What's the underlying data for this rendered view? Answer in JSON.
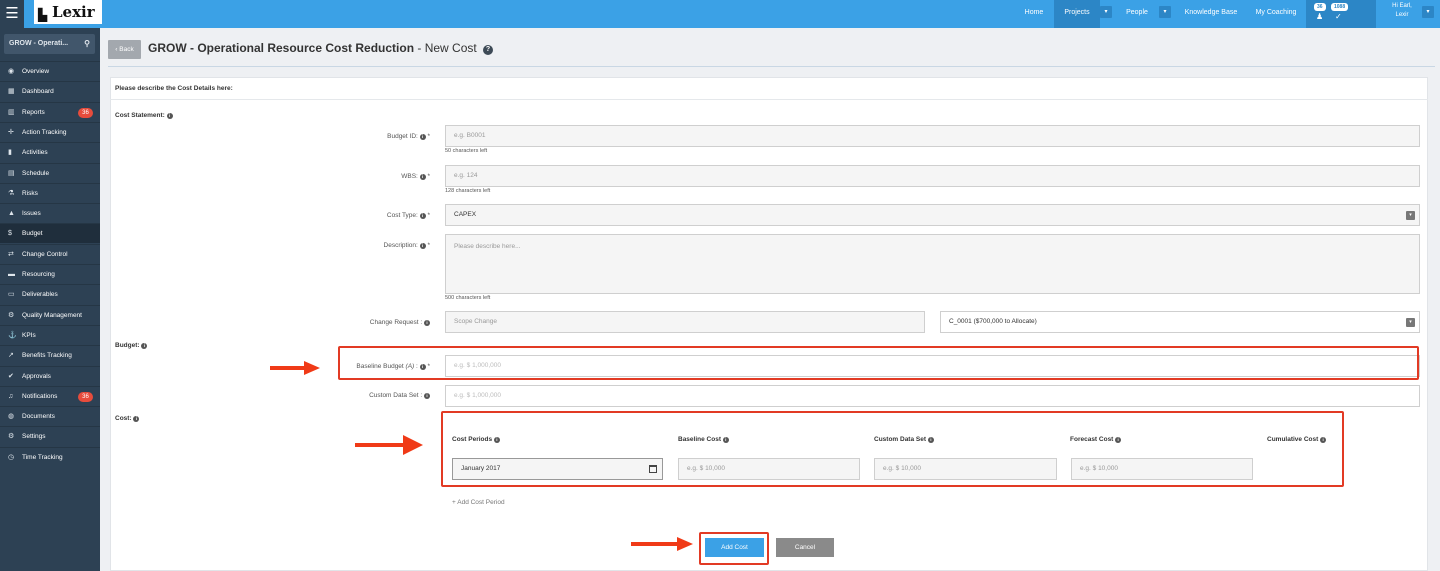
{
  "app": {
    "brand": "Lexir",
    "menu_icon": "hamburger-icon"
  },
  "topnav": {
    "items": [
      "Home",
      "Projects",
      "People",
      "Knowledge Base",
      "My Coaching"
    ],
    "notifications_count": "36",
    "messages_count": "1088",
    "user_greeting": "Hi Earl,",
    "user_name": "Lexir",
    "accent_color": "#3ba1e6"
  },
  "sidebar": {
    "search_text": "GROW - Operati...",
    "items": [
      {
        "label": "Overview",
        "icon": "eye-icon"
      },
      {
        "label": "Dashboard",
        "icon": "dashboard-icon"
      },
      {
        "label": "Reports",
        "icon": "chart-icon",
        "badge": "36"
      },
      {
        "label": "Action Tracking",
        "icon": "crosshair-icon"
      },
      {
        "label": "Activities",
        "icon": "bookmark-icon"
      },
      {
        "label": "Schedule",
        "icon": "calendar-icon"
      },
      {
        "label": "Risks",
        "icon": "flask-icon"
      },
      {
        "label": "Issues",
        "icon": "warning-icon"
      },
      {
        "label": "Budget",
        "icon": "dollar-icon",
        "active": true
      },
      {
        "label": "Change Control",
        "icon": "swap-icon"
      },
      {
        "label": "Resourcing",
        "icon": "folder-icon"
      },
      {
        "label": "Deliverables",
        "icon": "folder-open-icon"
      },
      {
        "label": "Quality Management",
        "icon": "gear-check-icon"
      },
      {
        "label": "KPIs",
        "icon": "anchor-icon"
      },
      {
        "label": "Benefits Tracking",
        "icon": "line-chart-icon"
      },
      {
        "label": "Approvals",
        "icon": "thumbs-up-icon"
      },
      {
        "label": "Notifications",
        "icon": "bell-icon",
        "badge": "36"
      },
      {
        "label": "Documents",
        "icon": "globe-icon"
      },
      {
        "label": "Settings",
        "icon": "gears-icon"
      },
      {
        "label": "Time Tracking",
        "icon": "clock-icon"
      }
    ]
  },
  "page": {
    "back_label": "Back",
    "title_bold": "GROW - Operational Resource Cost Reduction",
    "title_rest": " - New Cost",
    "panel_heading": "Please describe the Cost Details here:"
  },
  "form": {
    "cost_statement_label": "Cost Statement:",
    "budget_id": {
      "label": "Budget ID:",
      "placeholder": "e.g. B0001",
      "hint": "50 characters left"
    },
    "wbs": {
      "label": "WBS:",
      "placeholder": "e.g. 124",
      "hint": "128 characters left"
    },
    "cost_type": {
      "label": "Cost Type:",
      "value": "CAPEX"
    },
    "description": {
      "label": "Description:",
      "placeholder": "Please describe here...",
      "hint": "500 characters left"
    },
    "change_request": {
      "label": "Change Request :",
      "value": "Scope Change",
      "select_value": "C_0001 ($700,000 to Allocate)"
    },
    "budget_label": "Budget:",
    "baseline_budget": {
      "label": "Baseline Budget",
      "label_italic": "(A)",
      "label_suffix": " :",
      "placeholder": "e.g. $ 1,000,000"
    },
    "custom_data_set": {
      "label": "Custom Data Set :",
      "placeholder": "e.g. $ 1,000,000"
    },
    "cost_label": "Cost:",
    "cost_table": {
      "headers": [
        "Cost Periods",
        "Baseline Cost",
        "Custom Data Set",
        "Forecast Cost",
        "Cumulative Cost"
      ],
      "period_value": "January 2017",
      "placeholders": [
        "e.g. $ 10,000",
        "e.g. $ 10,000",
        "e.g. $ 10,000"
      ]
    },
    "add_period_label": "+ Add Cost Period",
    "add_cost_label": "Add Cost",
    "cancel_label": "Cancel"
  },
  "annotation_color": "#e23a24"
}
